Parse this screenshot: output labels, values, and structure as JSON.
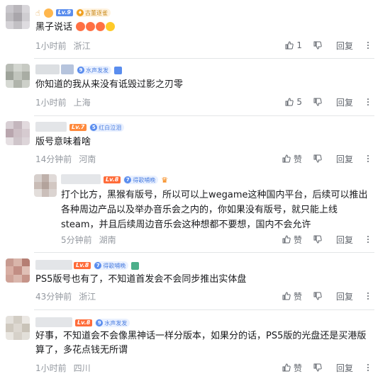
{
  "comments": [
    {
      "level": "Lv.9",
      "medal": "古董逐雀",
      "text": "黑子说话",
      "time": "1小时前",
      "location": "浙江",
      "likes": "1",
      "reply_label": "回复"
    },
    {
      "level": "",
      "medal": "水声发发",
      "text": "你知道的我从来没有诋毁过影之刃零",
      "time": "1小时前",
      "location": "上海",
      "likes": "5",
      "reply_label": "回复"
    },
    {
      "level": "Lv.7",
      "medal": "红白泣泪",
      "text": "版号意味着啥",
      "time": "14分钟前",
      "location": "河南",
      "like_label": "赞",
      "reply_label": "回复"
    },
    {
      "level": "Lv.8",
      "medal": "得歌哺晚",
      "text": "打个比方，黑猴有版号，所以可以上wegame这种国内平台，后续可以推出各种周边产品以及举办音乐会之内的，你如果没有版号，就只能上线steam，并且后续周边音乐会这种想都不要想，国内不会允许",
      "time": "5分钟前",
      "location": "湖南",
      "like_label": "赞",
      "reply_label": "回复"
    },
    {
      "level": "Lv.8",
      "medal": "得歌哺晚",
      "text": "PS5版号也有了，不知道首发会不会同步推出实体盘",
      "time": "43分钟前",
      "location": "浙江",
      "like_label": "赞",
      "reply_label": "回复"
    },
    {
      "level": "Lv.8",
      "medal": "水声发发",
      "text": "好事，不知道会不会像黑神话一样分版本，如果分的话，PS5版的光盘还是买港版算了，多花点钱无所谓",
      "time": "1小时前",
      "location": "四川",
      "like_label": "赞",
      "reply_label": "回复"
    }
  ],
  "colors": {
    "lv9": "#ff6c00",
    "lv8": "#ff6c00",
    "lv7": "#ff6c00",
    "medal_blue": "#5a8dee",
    "meta_gray": "#9499a0"
  },
  "icons": [
    "thumb-up-icon",
    "thumb-down-icon",
    "more-icon",
    "vip-icon",
    "emoji-icon"
  ]
}
